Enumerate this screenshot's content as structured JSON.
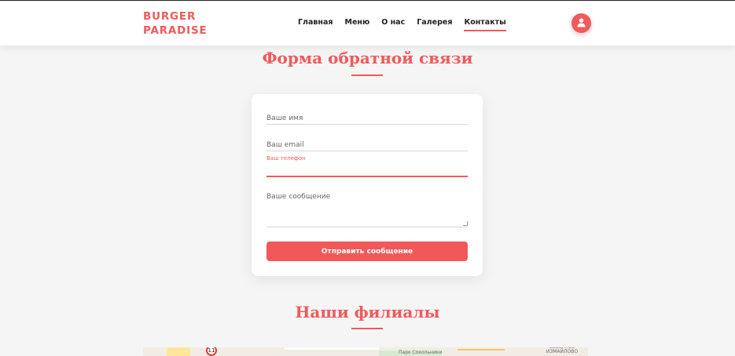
{
  "header": {
    "logo_line1": "BURGER",
    "logo_line2": "PARADISE",
    "nav": [
      "Главная",
      "Меню",
      "О нас",
      "Галерея",
      "Контакты"
    ],
    "active_nav": "Контакты",
    "profile_icon": "user-icon"
  },
  "feedback": {
    "title": "Форма обратной связи",
    "name_placeholder": "Ваше имя",
    "email_placeholder": "Ваш email",
    "phone_label": "Ваш телефон",
    "message_placeholder": "Ваше сообщение",
    "submit_label": "Отправить сообщение"
  },
  "branches": {
    "title": "Наши филиалы",
    "map_sign": "11",
    "map_label_1": "Парк Сокольники",
    "map_label_2": "СЕВЕРНОЕ ИЗМАЙЛОВО"
  },
  "colors": {
    "accent": "#f05a5b",
    "background": "#f5f5f5"
  }
}
